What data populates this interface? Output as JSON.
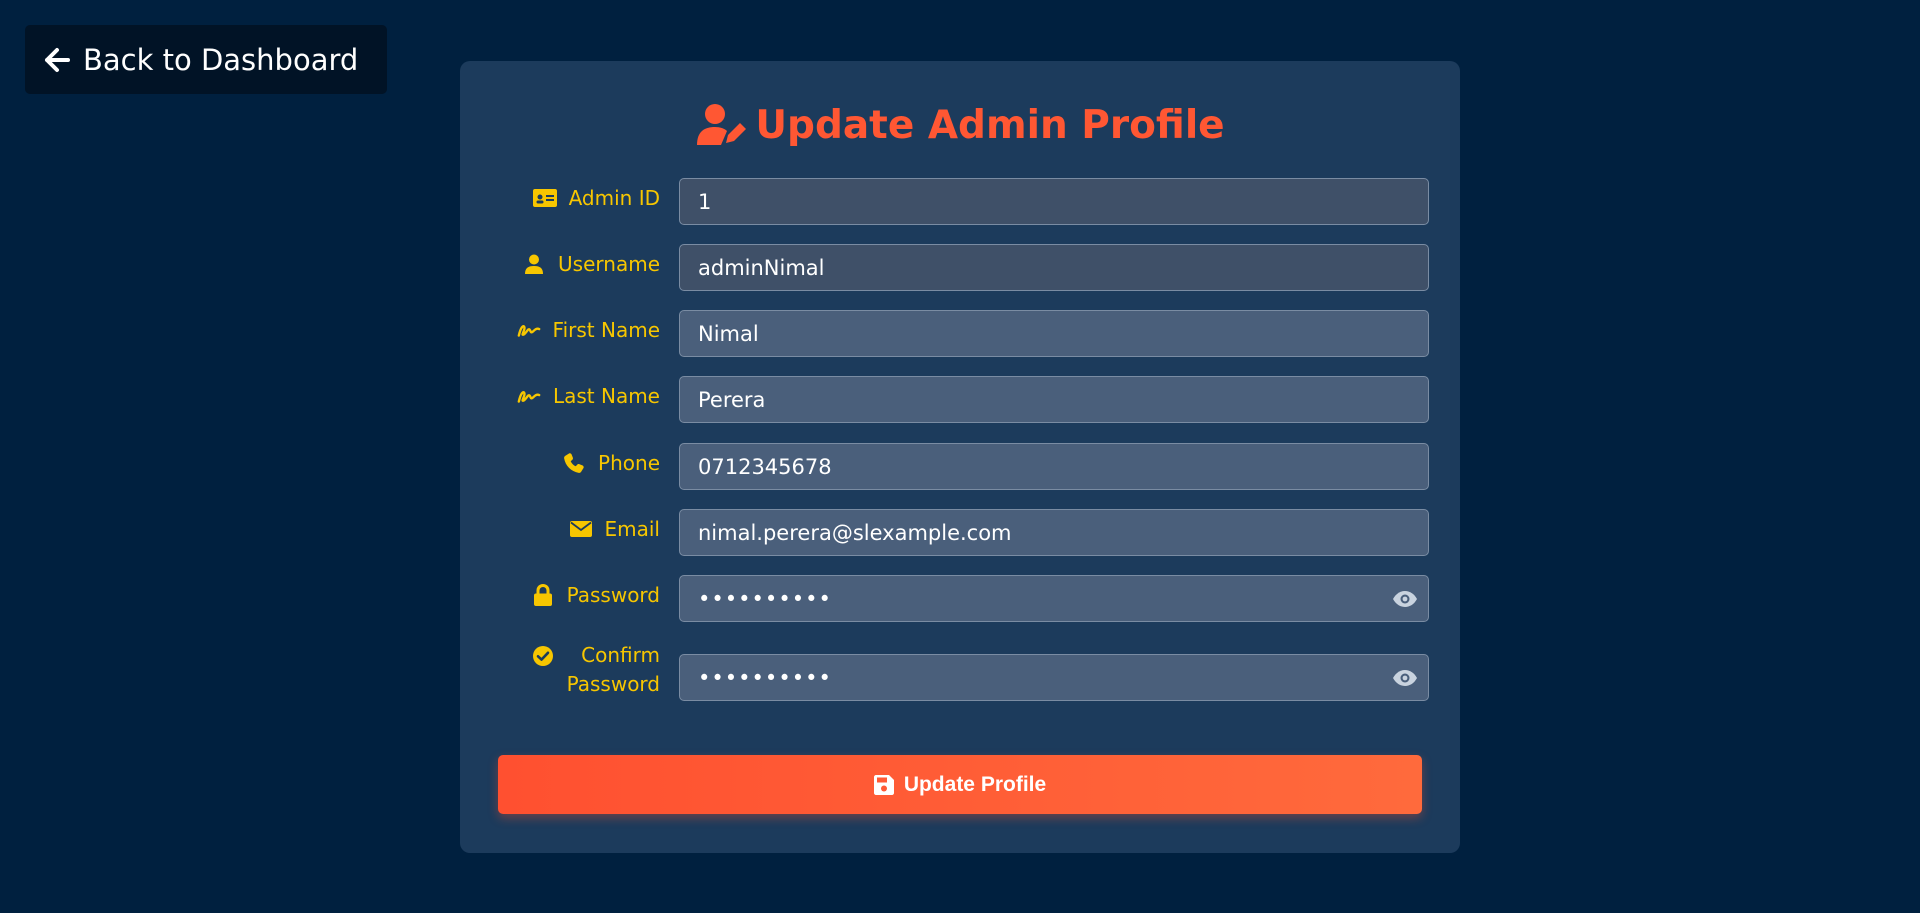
{
  "nav": {
    "back_label": "Back to Dashboard",
    "back_icon": "arrow-left-icon"
  },
  "form": {
    "title": "Update Admin Profile",
    "title_icon": "user-edit-icon",
    "fields": [
      {
        "label": "Admin ID",
        "icon": "id-card-icon",
        "value": "1"
      },
      {
        "label": "Username",
        "icon": "user-icon",
        "value": "adminNimal"
      },
      {
        "label": "First Name",
        "icon": "signature-icon",
        "value": "Nimal"
      },
      {
        "label": "Last Name",
        "icon": "signature-icon",
        "value": "Perera"
      },
      {
        "label": "Phone",
        "icon": "phone-icon",
        "value": "0712345678"
      },
      {
        "label": "Email",
        "icon": "envelope-icon",
        "value": "nimal.perera@slexample.com"
      },
      {
        "label": "Password",
        "icon": "lock-icon",
        "value": "••••••••••"
      },
      {
        "label_line1": "Confirm",
        "label_line2": "Password",
        "icon": "check-circle-icon",
        "value": "••••••••••"
      }
    ],
    "submit_label": "Update Profile",
    "submit_icon": "save-icon"
  },
  "colors": {
    "background": "#00203f",
    "card": "#1c3b5c",
    "accent": "#ff5733",
    "label": "#f7c600",
    "input": "#4a5f7b"
  }
}
